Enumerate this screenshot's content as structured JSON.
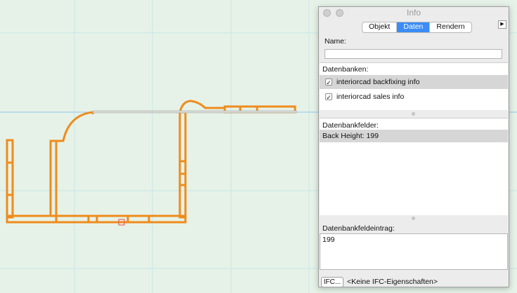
{
  "palette": {
    "title": "Info",
    "tabs": [
      {
        "label": "Objekt",
        "active": false
      },
      {
        "label": "Daten",
        "active": true
      },
      {
        "label": "Rendern",
        "active": false
      }
    ],
    "name_label": "Name:",
    "name_value": "",
    "datenbanken_label": "Datenbanken:",
    "datenbanken": [
      {
        "label": "interiorcad backfixing info",
        "checked": true,
        "selected": true
      },
      {
        "label": "interiorcad sales info",
        "checked": true,
        "selected": false
      }
    ],
    "felder_label": "Datenbankfelder:",
    "felder": [
      {
        "label": "Back Height: 199",
        "selected": true
      }
    ],
    "eintrag_label": "Datenbankfeldeintrag:",
    "eintrag_value": "199",
    "ifc_button": "IFC...",
    "ifc_status": "<Keine IFC-Eigenschaften>",
    "check_glyph": "✓",
    "expand_glyph": "▶"
  },
  "colors": {
    "canvas_bg": "#e6f2e8",
    "grid": "#c7e7e6",
    "grid_axis": "#9fd0ea",
    "drawing": "#ef8c1c",
    "accent": "#3b8cf6"
  }
}
